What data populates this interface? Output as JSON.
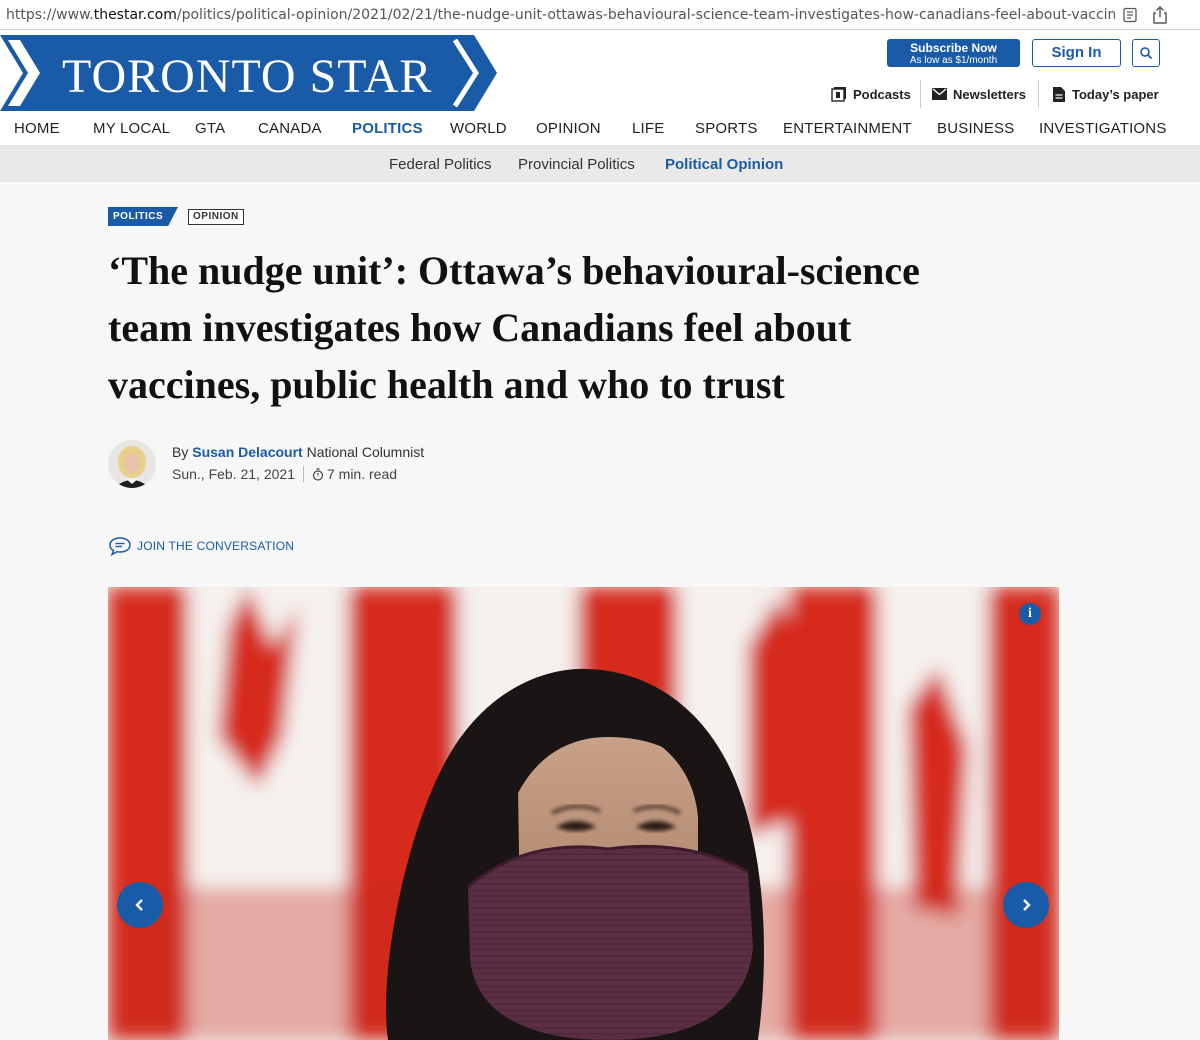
{
  "browser": {
    "url_prefix": "https://www.",
    "url_domain": "thestar.com",
    "url_path": "/politics/political-opinion/2021/02/21/the-nudge-unit-ottawas-behavioural-science-team-investigates-how-canadians-feel-about-vaccines-public-healt"
  },
  "masthead": {
    "logo": "TORONTO STAR",
    "subscribe_label": "Subscribe Now",
    "subscribe_sub": "As low as $1/month",
    "signin_label": "Sign In",
    "utility": [
      "Podcasts",
      "Newsletters",
      "Today’s paper"
    ]
  },
  "nav": {
    "items": [
      "HOME",
      "MY LOCAL",
      "GTA",
      "CANADA",
      "POLITICS",
      "WORLD",
      "OPINION",
      "LIFE",
      "SPORTS",
      "ENTERTAINMENT",
      "BUSINESS",
      "INVESTIGATIONS"
    ],
    "active": "POLITICS",
    "sub_items": [
      "Federal Politics",
      "Provincial Politics",
      "Political Opinion"
    ],
    "sub_active": "Political Opinion"
  },
  "article": {
    "section_tag": "POLITICS",
    "type_tag": "OPINION",
    "headline_lines": [
      "‘The nudge unit’: Ottawa’s behavioural-science",
      "team investigates how Canadians feel about",
      "vaccines, public health and who to trust"
    ],
    "by": "By",
    "author": "Susan Delacourt",
    "author_role": "National Columnist",
    "date": "Sun., Feb. 21, 2021",
    "read_time": "7 min. read",
    "conversation_label": "JOIN THE CONVERSATION"
  },
  "colors": {
    "brand_blue": "#1a5ba8",
    "flag_red": "#d52b1e"
  },
  "icons": [
    "reader-view-icon",
    "share-icon",
    "search-icon",
    "podcast-icon",
    "mail-icon",
    "newspaper-icon",
    "stopwatch-icon",
    "chat-bubble-icon",
    "info-icon",
    "chevron-left-icon",
    "chevron-right-icon"
  ]
}
